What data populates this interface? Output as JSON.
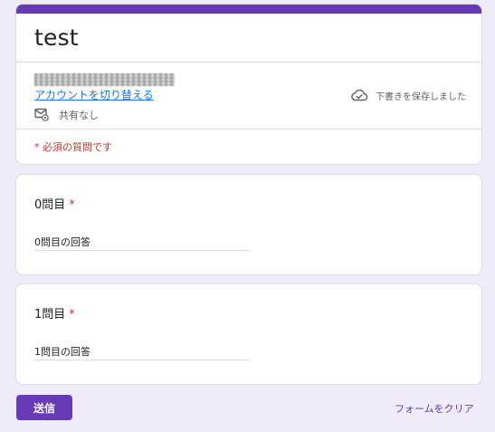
{
  "header": {
    "form_title": "test",
    "switch_account": "アカウントを切り替える",
    "share_status": "共有なし",
    "save_status": "下書きを保存しました",
    "required_note": "* 必須の質問です",
    "icons": {
      "share": "mail-gear-icon",
      "save": "cloud-check-icon"
    }
  },
  "questions": [
    {
      "title": "0問目",
      "required_mark": "*",
      "answer_placeholder": "0問目の回答"
    },
    {
      "title": "1問目",
      "required_mark": "*",
      "answer_placeholder": "1問目の回答"
    }
  ],
  "footer": {
    "submit_label": "送信",
    "clear_label": "フォームをクリア"
  },
  "colors": {
    "accent": "#673ab7",
    "background": "#f0ebf8",
    "required": "#d93025",
    "link": "#1a73e8"
  }
}
